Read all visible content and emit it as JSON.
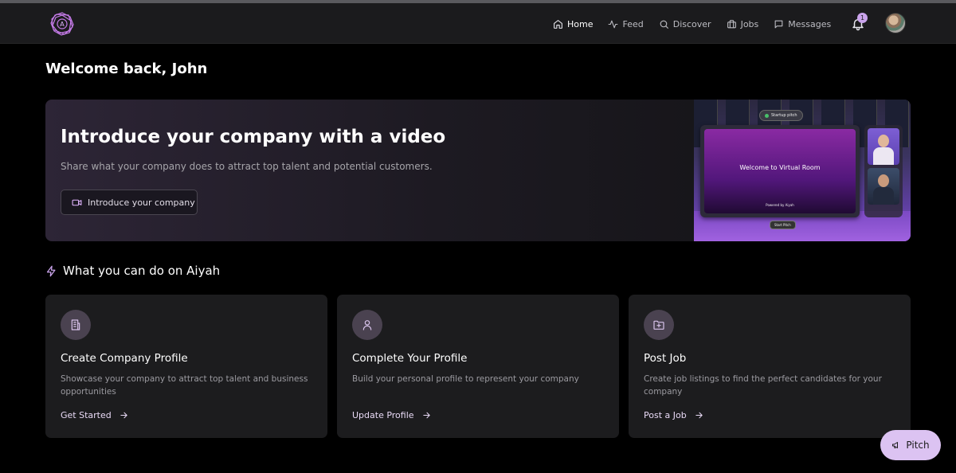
{
  "nav": {
    "items": [
      {
        "label": "Home",
        "icon": "home-icon"
      },
      {
        "label": "Feed",
        "icon": "activity-icon"
      },
      {
        "label": "Discover",
        "icon": "search-icon"
      },
      {
        "label": "Jobs",
        "icon": "briefcase-icon"
      },
      {
        "label": "Messages",
        "icon": "message-icon"
      }
    ],
    "notifications_count": "1"
  },
  "welcome": "Welcome back, John",
  "hero": {
    "title": "Introduce your company with a video",
    "subtitle": "Share what your company does to attract top talent and potential customers.",
    "button_label": "Introduce your company",
    "preview": {
      "pill": "Startup pitch",
      "screen_title": "Welcome to Virtual Room",
      "screen_footer": "Powered by Aiyah",
      "start_label": "Start Pitch"
    }
  },
  "section": {
    "title": "What you can do on Aiyah"
  },
  "cards": [
    {
      "title": "Create Company Profile",
      "description": "Showcase your company to attract top talent and business opportunities",
      "link": "Get Started",
      "icon": "building-icon"
    },
    {
      "title": "Complete Your Profile",
      "description": "Build your personal profile to represent your company",
      "link": "Update Profile",
      "icon": "user-icon"
    },
    {
      "title": "Post Job",
      "description": "Create job listings to find the perfect candidates for your company",
      "link": "Post a Job",
      "icon": "folder-plus-icon"
    }
  ],
  "pitch_button": "Pitch",
  "colors": {
    "accent": "#caa4ec",
    "page_bg": "#000000",
    "card_bg": "#1c1c1e",
    "navbar_bg": "#1b1b1d"
  }
}
